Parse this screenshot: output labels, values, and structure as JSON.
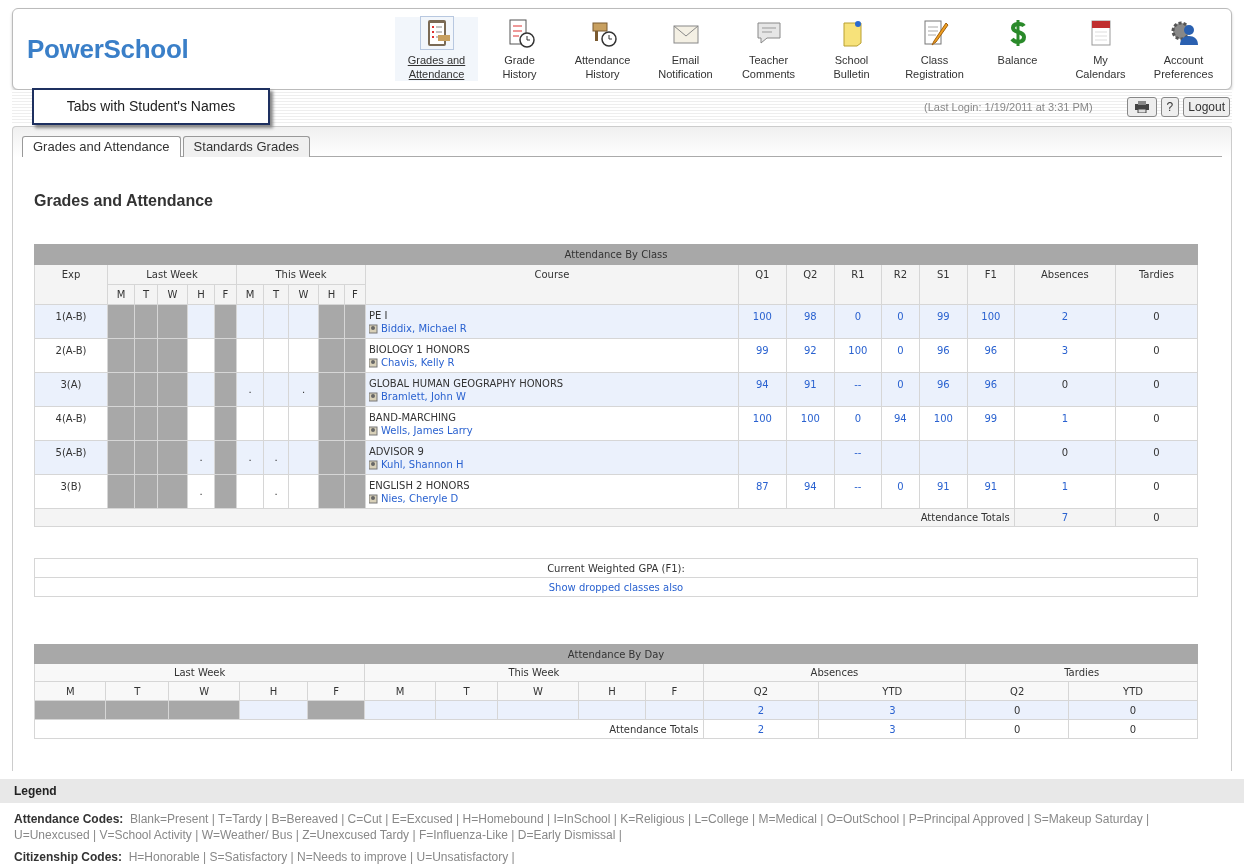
{
  "logo": "PowerSchool",
  "nav": [
    {
      "label": "Grades and Attendance",
      "selected": true
    },
    {
      "label": "Grade History",
      "selected": false
    },
    {
      "label": "Attendance History",
      "selected": false
    },
    {
      "label": "Email Notification",
      "selected": false
    },
    {
      "label": "Teacher Comments",
      "selected": false
    },
    {
      "label": "School Bulletin",
      "selected": false
    },
    {
      "label": "Class Registration",
      "selected": false
    },
    {
      "label": "Balance",
      "selected": false
    },
    {
      "label": "My Calendars",
      "selected": false
    },
    {
      "label": "Account Preferences",
      "selected": false
    }
  ],
  "callout": "Tabs with Student's Names",
  "last_login": "(Last Login: 1/19/2011 at 3:31 PM)",
  "logout": "Logout",
  "help": "?",
  "tabs": [
    {
      "label": "Grades and Attendance",
      "selected": true
    },
    {
      "label": "Standards Grades",
      "selected": false
    }
  ],
  "heading": "Grades and Attendance",
  "class_table": {
    "title": "Attendance By Class",
    "exp_header": "Exp",
    "last_week": "Last Week",
    "this_week": "This Week",
    "course_header": "Course",
    "day_headers": [
      "M",
      "T",
      "W",
      "H",
      "F",
      "M",
      "T",
      "W",
      "H",
      "F"
    ],
    "grade_headers": [
      "Q1",
      "Q2",
      "R1",
      "R2",
      "S1",
      "F1"
    ],
    "absences_header": "Absences",
    "tardies_header": "Tardies",
    "rows": [
      {
        "exp": "1(A-B)",
        "course": "PE I",
        "teacher": "Biddix, Michael R",
        "days": [
          {
            "shaded": true
          },
          {
            "shaded": true
          },
          {
            "shaded": true
          },
          {
            "shaded": false
          },
          {
            "shaded": true
          },
          {
            "shaded": false
          },
          {
            "shaded": false
          },
          {
            "shaded": false
          },
          {
            "shaded": true
          },
          {
            "shaded": true
          }
        ],
        "grades": {
          "q1": {
            "text": "100",
            "link": true
          },
          "q2": {
            "text": "98",
            "link": true
          },
          "r1": {
            "text": "0",
            "link": true
          },
          "r2": {
            "text": "0",
            "link": true
          },
          "s1": {
            "text": "99",
            "link": true
          },
          "f1": {
            "text": "100",
            "link": true
          }
        },
        "absences": {
          "text": "2",
          "link": true
        },
        "tardies": "0"
      },
      {
        "exp": "2(A-B)",
        "course": "BIOLOGY 1 HONORS",
        "teacher": "Chavis, Kelly R",
        "days": [
          {
            "shaded": true
          },
          {
            "shaded": true
          },
          {
            "shaded": true
          },
          {
            "shaded": false
          },
          {
            "shaded": true
          },
          {
            "shaded": false
          },
          {
            "shaded": false
          },
          {
            "shaded": false
          },
          {
            "shaded": true
          },
          {
            "shaded": true
          }
        ],
        "grades": {
          "q1": {
            "text": "99",
            "link": true
          },
          "q2": {
            "text": "92",
            "link": true
          },
          "r1": {
            "text": "100",
            "link": true
          },
          "r2": {
            "text": "0",
            "link": true
          },
          "s1": {
            "text": "96",
            "link": true
          },
          "f1": {
            "text": "96",
            "link": true
          }
        },
        "absences": {
          "text": "3",
          "link": true
        },
        "tardies": "0"
      },
      {
        "exp": "3(A)",
        "course": "GLOBAL HUMAN GEOGRAPHY HONORS",
        "teacher": "Bramlett, John W",
        "days": [
          {
            "shaded": true
          },
          {
            "shaded": true
          },
          {
            "shaded": true
          },
          {
            "shaded": false
          },
          {
            "shaded": true
          },
          {
            "shaded": false,
            "text": "."
          },
          {
            "shaded": false
          },
          {
            "shaded": false,
            "text": "."
          },
          {
            "shaded": true
          },
          {
            "shaded": true
          }
        ],
        "grades": {
          "q1": {
            "text": "94",
            "link": true
          },
          "q2": {
            "text": "91",
            "link": true
          },
          "r1": {
            "text": "--",
            "link": true
          },
          "r2": {
            "text": "0",
            "link": true
          },
          "s1": {
            "text": "96",
            "link": true
          },
          "f1": {
            "text": "96",
            "link": true
          }
        },
        "absences": {
          "text": "0",
          "link": false
        },
        "tardies": "0"
      },
      {
        "exp": "4(A-B)",
        "course": "BAND-MARCHING",
        "teacher": "Wells, James Larry",
        "days": [
          {
            "shaded": true
          },
          {
            "shaded": true
          },
          {
            "shaded": true
          },
          {
            "shaded": false
          },
          {
            "shaded": true
          },
          {
            "shaded": false
          },
          {
            "shaded": false
          },
          {
            "shaded": false
          },
          {
            "shaded": true
          },
          {
            "shaded": true
          }
        ],
        "grades": {
          "q1": {
            "text": "100",
            "link": true
          },
          "q2": {
            "text": "100",
            "link": true
          },
          "r1": {
            "text": "0",
            "link": true
          },
          "r2": {
            "text": "94",
            "link": true
          },
          "s1": {
            "text": "100",
            "link": true
          },
          "f1": {
            "text": "99",
            "link": true
          }
        },
        "absences": {
          "text": "1",
          "link": true
        },
        "tardies": "0"
      },
      {
        "exp": "5(A-B)",
        "course": "ADVISOR 9",
        "teacher": "Kuhl, Shannon H",
        "days": [
          {
            "shaded": true
          },
          {
            "shaded": true
          },
          {
            "shaded": true
          },
          {
            "shaded": false,
            "text": "."
          },
          {
            "shaded": true
          },
          {
            "shaded": false,
            "text": "."
          },
          {
            "shaded": false,
            "text": "."
          },
          {
            "shaded": false
          },
          {
            "shaded": true
          },
          {
            "shaded": true
          }
        ],
        "grades": {
          "r1": {
            "text": "--",
            "link": true
          }
        },
        "absences": {
          "text": "0",
          "link": false
        },
        "tardies": "0"
      },
      {
        "exp": "3(B)",
        "course": "ENGLISH 2 HONORS",
        "teacher": "Nies, Cheryle D",
        "days": [
          {
            "shaded": true
          },
          {
            "shaded": true
          },
          {
            "shaded": true
          },
          {
            "shaded": false,
            "text": "."
          },
          {
            "shaded": true
          },
          {
            "shaded": false
          },
          {
            "shaded": false,
            "text": "."
          },
          {
            "shaded": false
          },
          {
            "shaded": true
          },
          {
            "shaded": true
          }
        ],
        "grades": {
          "q1": {
            "text": "87",
            "link": true
          },
          "q2": {
            "text": "94",
            "link": true
          },
          "r1": {
            "text": "--",
            "link": true
          },
          "r2": {
            "text": "0",
            "link": true
          },
          "s1": {
            "text": "91",
            "link": true
          },
          "f1": {
            "text": "91",
            "link": true
          }
        },
        "absences": {
          "text": "1",
          "link": true
        },
        "tardies": "0"
      }
    ],
    "totals_label": "Attendance Totals",
    "totals_absences": "7",
    "totals_tardies": "0"
  },
  "gpa_label": "Current Weighted GPA (F1):",
  "dropped_link": "Show dropped classes also",
  "day_table": {
    "title": "Attendance By Day",
    "last_week": "Last Week",
    "this_week": "This Week",
    "absences_header": "Absences",
    "tardies_header": "Tardies",
    "day_headers": [
      "M",
      "T",
      "W",
      "H",
      "F",
      "M",
      "T",
      "W",
      "H",
      "F"
    ],
    "sub_headers": [
      "Q2",
      "YTD",
      "Q2",
      "YTD"
    ],
    "days": [
      {
        "shaded": true
      },
      {
        "shaded": true
      },
      {
        "shaded": true
      },
      {
        "shaded": false
      },
      {
        "shaded": true
      },
      {
        "shaded": false
      },
      {
        "shaded": false
      },
      {
        "shaded": false
      },
      {
        "shaded": false
      },
      {
        "shaded": false
      }
    ],
    "counts": [
      {
        "text": "2",
        "link": true
      },
      {
        "text": "3",
        "link": true
      },
      {
        "text": "0",
        "link": false
      },
      {
        "text": "0",
        "link": false
      }
    ],
    "totals_label": "Attendance Totals",
    "totals": [
      {
        "text": "2",
        "link": true
      },
      {
        "text": "3",
        "link": true
      },
      {
        "text": "0",
        "link": false
      },
      {
        "text": "0",
        "link": false
      }
    ]
  },
  "legend": {
    "title": "Legend",
    "lines": [
      "**Attendance Codes:**  Blank=Present | T=Tardy | B=Bereaved | C=Cut | E=Excused | H=Homebound | I=InSchool | K=Religious | L=College | M=Medical | O=OutSchool | P=Principal Approved | S=Makeup Saturday | U=Unexcused | V=School Activity | W=Weather/ Bus | Z=Unexcused Tardy | F=Influenza-Like | D=Early Dismissal |",
      "**Citizenship Codes:**  H=Honorable | S=Satisfactory | N=Needs to improve | U=Unsatisfactory |"
    ]
  }
}
